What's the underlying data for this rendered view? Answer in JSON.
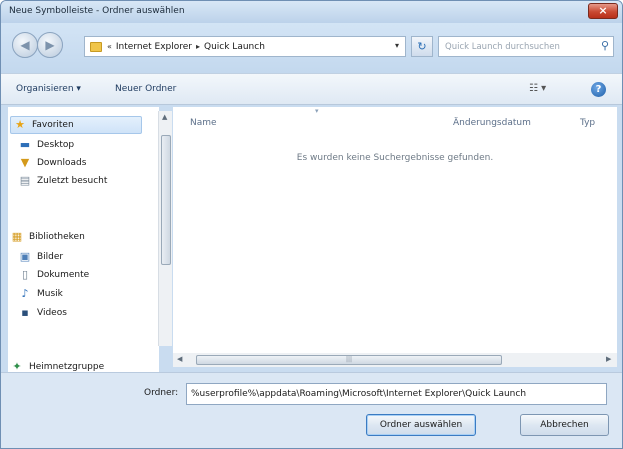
{
  "window": {
    "title": "Neue Symbolleiste - Ordner auswählen",
    "close_symbol": "×"
  },
  "nav": {
    "back_icon": "back-arrow-icon",
    "forward_icon": "forward-arrow-icon",
    "back_glyph": "◀",
    "forward_glyph": "▶",
    "address_prefix": "«",
    "address_segments": [
      "Internet Explorer",
      "Quick Launch"
    ],
    "address_sep": "▸",
    "dropdown_glyph": "▾",
    "refresh_glyph": "↻",
    "search_placeholder": "Quick Launch durchsuchen",
    "search_glyph": "⚲"
  },
  "toolbar": {
    "organize_label": "Organisieren ▾",
    "new_folder_label": "Neuer Ordner",
    "view_glyph": "☷ ▾",
    "help_glyph": "?"
  },
  "navpane": {
    "items": [
      {
        "label": "Favoriten",
        "icon": "star-icon",
        "glyph": "★",
        "color": "#e8a417"
      },
      {
        "label": "Desktop",
        "icon": "desktop-icon",
        "glyph": "▬",
        "color": "#2e6fb8"
      },
      {
        "label": "Downloads",
        "icon": "downloads-icon",
        "glyph": "▼",
        "color": "#d49a1c"
      },
      {
        "label": "Zuletzt besucht",
        "icon": "recent-icon",
        "glyph": "▤",
        "color": "#7a8a99"
      },
      {
        "label": "Bibliotheken",
        "icon": "libraries-icon",
        "glyph": "▦",
        "color": "#d49a1c"
      },
      {
        "label": "Bilder",
        "icon": "pictures-icon",
        "glyph": "▣",
        "color": "#4d7fb8"
      },
      {
        "label": "Dokumente",
        "icon": "documents-icon",
        "glyph": "▯",
        "color": "#6f7f8f"
      },
      {
        "label": "Musik",
        "icon": "music-icon",
        "glyph": "♪",
        "color": "#2e6fb8"
      },
      {
        "label": "Videos",
        "icon": "videos-icon",
        "glyph": "▪",
        "color": "#2b4f7a"
      },
      {
        "label": "Heimnetzgruppe",
        "icon": "homegroup-icon",
        "glyph": "✦",
        "color": "#2f8f4a"
      }
    ]
  },
  "content": {
    "columns": [
      "Name",
      "Änderungsdatum",
      "Typ"
    ],
    "sort_glyph": "▾",
    "empty_message": "Es wurden keine Suchergebnisse gefunden."
  },
  "scrollbars": {
    "up": "▲",
    "down": "▼",
    "left": "◀",
    "right": "▶",
    "grip": "|||"
  },
  "bottom": {
    "folder_label": "Ordner:",
    "folder_value": "%userprofile%\\appdata\\Roaming\\Microsoft\\Internet Explorer\\Quick Launch",
    "ok_label": "Ordner auswählen",
    "cancel_label": "Abbrechen"
  }
}
